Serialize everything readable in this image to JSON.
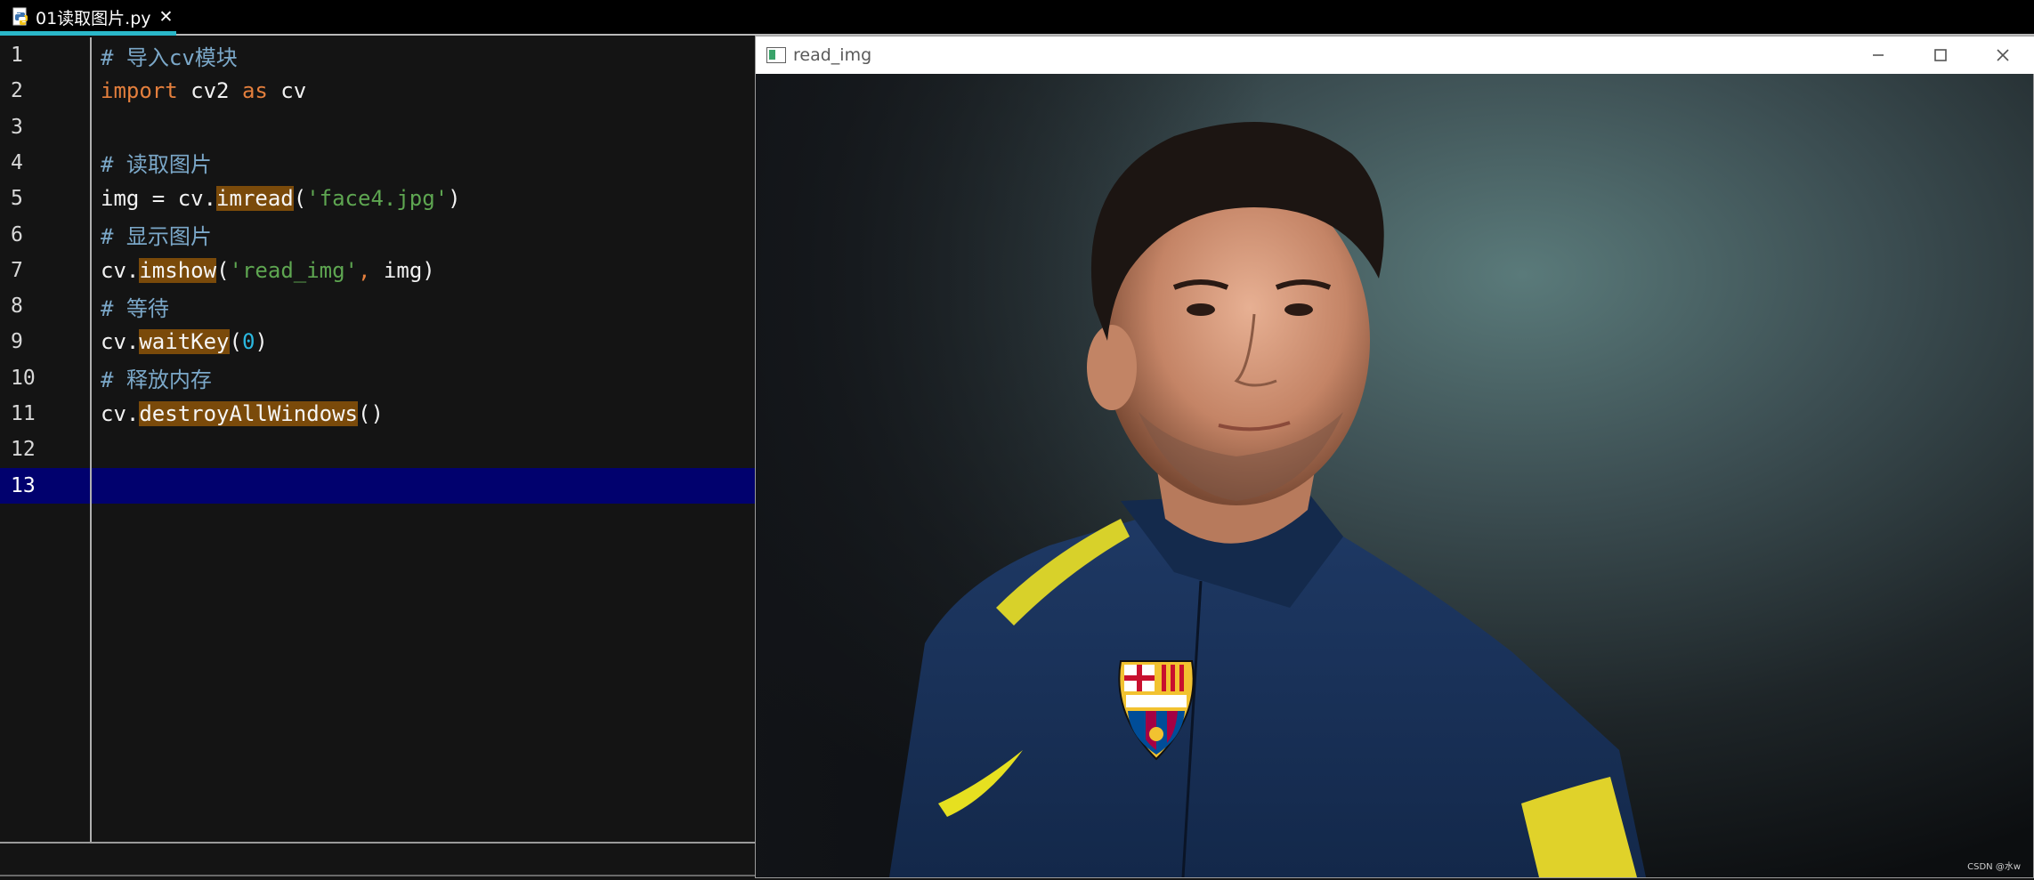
{
  "tab": {
    "title": "01读取图片.py",
    "close_glyph": "✕",
    "icon": "python-file-icon",
    "accent": "#2ab7c9"
  },
  "editor": {
    "current_line": 13,
    "lines": [
      {
        "n": "1",
        "tokens": [
          [
            "c-comment",
            "# 导入cv模块"
          ]
        ]
      },
      {
        "n": "2",
        "tokens": [
          [
            "c-kw",
            "import"
          ],
          [
            "",
            " cv2 "
          ],
          [
            "c-kw",
            "as"
          ],
          [
            "",
            " cv"
          ]
        ]
      },
      {
        "n": "3",
        "tokens": []
      },
      {
        "n": "4",
        "tokens": [
          [
            "c-comment",
            "# 读取图片"
          ]
        ]
      },
      {
        "n": "5",
        "tokens": [
          [
            "",
            "img = cv."
          ],
          [
            "c-fn",
            "imread"
          ],
          [
            "",
            "("
          ],
          [
            "c-str",
            "'face4.jpg'"
          ],
          [
            "",
            ")"
          ]
        ]
      },
      {
        "n": "6",
        "tokens": [
          [
            "c-comment",
            "# 显示图片"
          ]
        ]
      },
      {
        "n": "7",
        "tokens": [
          [
            "",
            "cv."
          ],
          [
            "c-fn",
            "imshow"
          ],
          [
            "",
            "("
          ],
          [
            "c-str",
            "'read_img'"
          ],
          [
            "c-comma",
            ","
          ],
          [
            "",
            " img)"
          ]
        ]
      },
      {
        "n": "8",
        "tokens": [
          [
            "c-comment",
            "# 等待"
          ]
        ]
      },
      {
        "n": "9",
        "tokens": [
          [
            "",
            "cv."
          ],
          [
            "c-fn",
            "waitKey"
          ],
          [
            "",
            "("
          ],
          [
            "c-num",
            "0"
          ],
          [
            "",
            ")"
          ]
        ]
      },
      {
        "n": "10",
        "tokens": [
          [
            "c-comment",
            "# 释放内存"
          ]
        ]
      },
      {
        "n": "11",
        "tokens": [
          [
            "",
            "cv."
          ],
          [
            "c-fn",
            "destroyAllWindows"
          ],
          [
            "",
            "()"
          ]
        ]
      },
      {
        "n": "12",
        "tokens": []
      },
      {
        "n": "13",
        "tokens": []
      }
    ],
    "colors": {
      "background": "#141414",
      "current_line": "#01016e",
      "comment": "#7ba8c9",
      "keyword": "#e47f3d",
      "string": "#5ea651",
      "number": "#2bb8e0",
      "function_highlight": "#7a4a0a"
    }
  },
  "image_window": {
    "title": "read_img",
    "icon": "opencv-window-icon",
    "controls": [
      "minimize-icon",
      "maximize-icon",
      "close-icon"
    ],
    "watermark": "CSDN @水w"
  }
}
